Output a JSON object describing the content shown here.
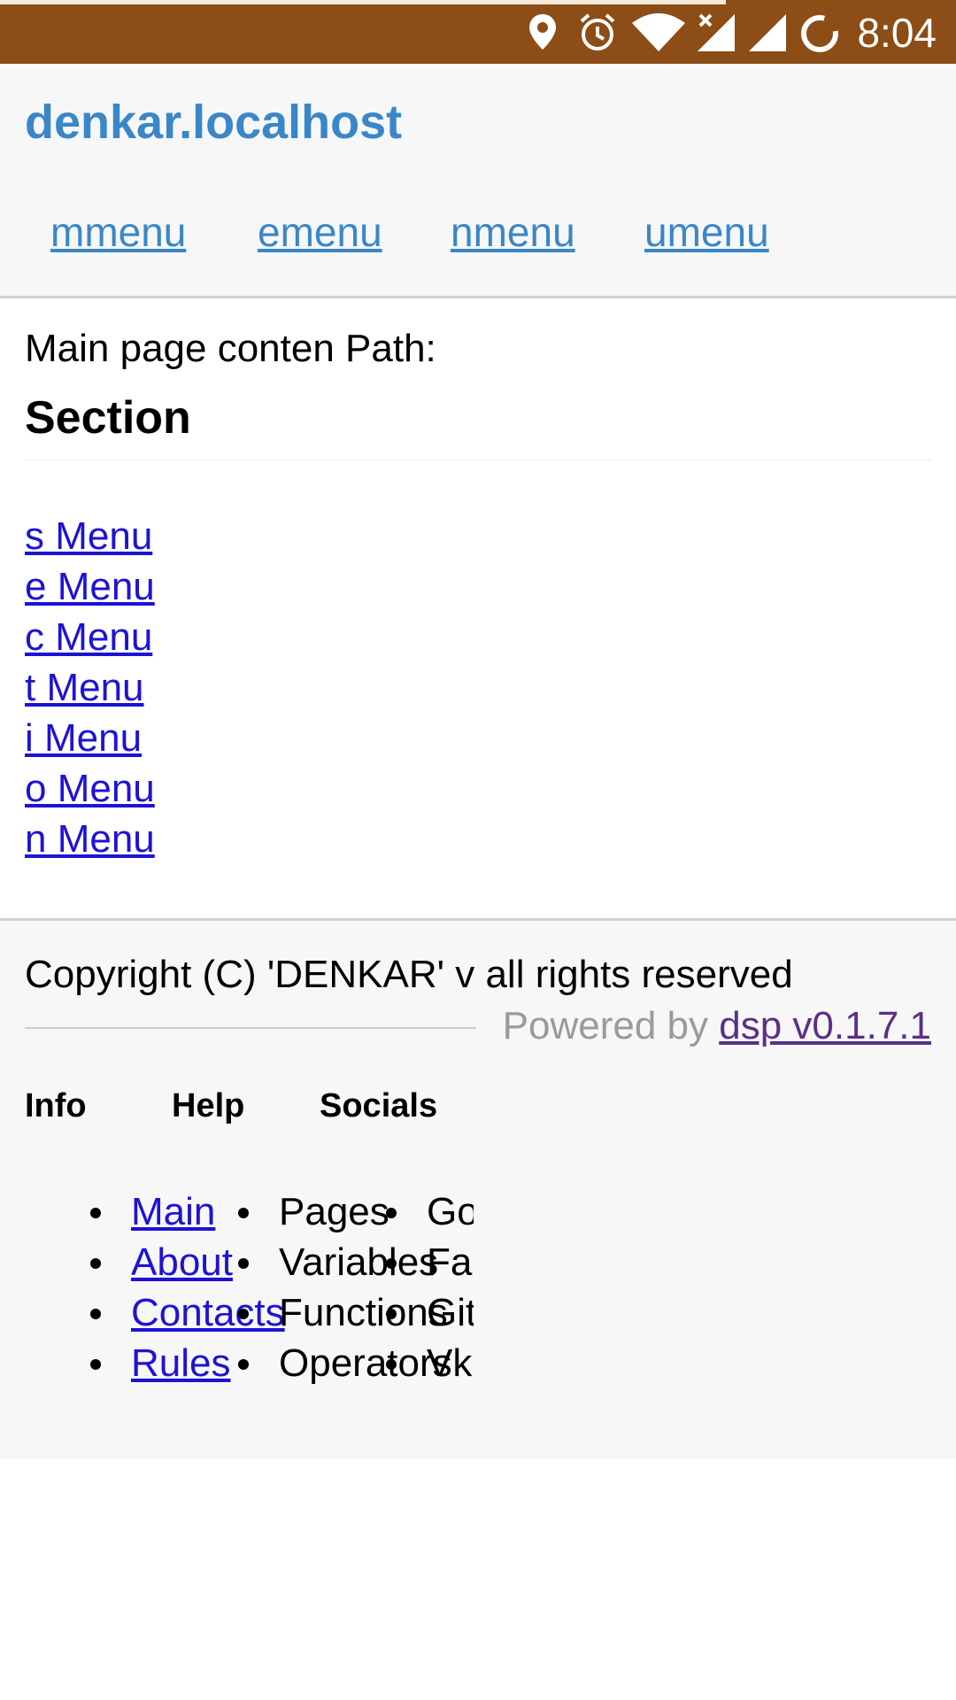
{
  "status_bar": {
    "time": "8:04",
    "icons": [
      "location-icon",
      "alarm-icon",
      "wifi-icon",
      "signal-x-icon",
      "signal-icon",
      "sync-icon"
    ]
  },
  "header": {
    "site_title": "denkar.localhost",
    "nav": [
      "mmenu",
      "emenu",
      "nmenu",
      "umenu"
    ]
  },
  "main": {
    "text": "Main page conten Path:",
    "section_heading": "Section",
    "menu_links": [
      "s Menu",
      "e Menu",
      "c Menu",
      "t Menu",
      "i Menu",
      "o Menu",
      "n Menu"
    ]
  },
  "footer": {
    "copyright": "Copyright (C) 'DENKAR' v all rights reserved",
    "powered_prefix": "Powered by",
    "powered_link": "dsp v0.1.7.1",
    "columns": {
      "info": {
        "heading": "Info",
        "items": [
          "Main",
          "About",
          "Contacts",
          "Rules"
        ]
      },
      "help": {
        "heading": "Help",
        "items": [
          "Pages",
          "Variables",
          "Functions",
          "Operators"
        ]
      },
      "socials": {
        "heading": "Socials",
        "items": [
          "Go",
          "Fa",
          "Git",
          "Vk"
        ]
      }
    }
  },
  "colors": {
    "status_bar": "#8c4d16",
    "link_blue": "#3a87c8",
    "link_dark_blue": "#1d13d4",
    "visited_purple": "#5b2f86"
  }
}
